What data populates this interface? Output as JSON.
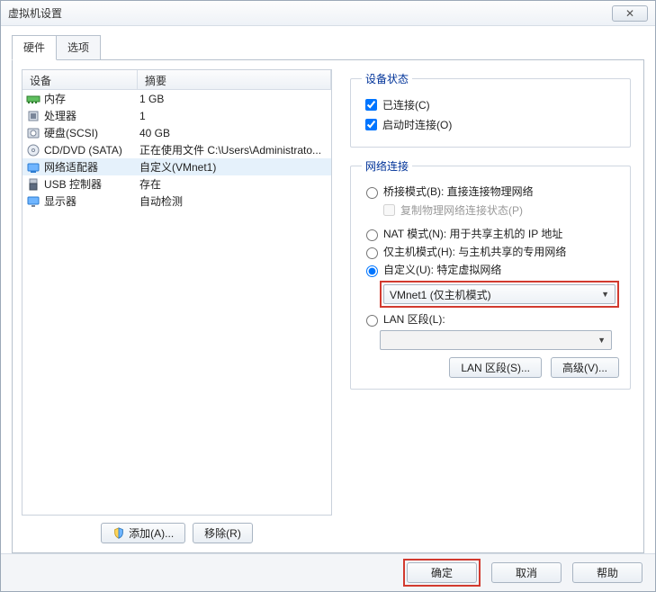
{
  "window": {
    "title": "虚拟机设置"
  },
  "tabs": {
    "hardware": "硬件",
    "options": "选项"
  },
  "list": {
    "header_device": "设备",
    "header_summary": "摘要",
    "rows": [
      {
        "icon": "memory",
        "device": "内存",
        "summary": "1 GB"
      },
      {
        "icon": "cpu",
        "device": "处理器",
        "summary": "1"
      },
      {
        "icon": "disk",
        "device": "硬盘(SCSI)",
        "summary": "40 GB"
      },
      {
        "icon": "cd",
        "device": "CD/DVD (SATA)",
        "summary": "正在使用文件 C:\\Users\\Administrato..."
      },
      {
        "icon": "net",
        "device": "网络适配器",
        "summary": "自定义(VMnet1)",
        "selected": true
      },
      {
        "icon": "usb",
        "device": "USB 控制器",
        "summary": "存在"
      },
      {
        "icon": "display",
        "device": "显示器",
        "summary": "自动检测"
      }
    ]
  },
  "buttons": {
    "add": "添加(A)...",
    "remove": "移除(R)"
  },
  "status": {
    "legend": "设备状态",
    "connected": "已连接(C)",
    "connect_at_poweron": "启动时连接(O)"
  },
  "network": {
    "legend": "网络连接",
    "bridged": "桥接模式(B): 直接连接物理网络",
    "replicate": "复制物理网络连接状态(P)",
    "nat": "NAT 模式(N): 用于共享主机的 IP 地址",
    "hostonly": "仅主机模式(H): 与主机共享的专用网络",
    "custom": "自定义(U): 特定虚拟网络",
    "custom_value": "VMnet1 (仅主机模式)",
    "lan": "LAN 区段(L):",
    "lan_segments_btn": "LAN 区段(S)...",
    "advanced_btn": "高级(V)..."
  },
  "footer": {
    "ok": "确定",
    "cancel": "取消",
    "help": "帮助"
  }
}
